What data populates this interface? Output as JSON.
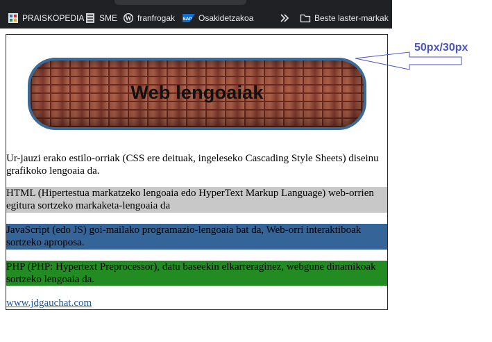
{
  "bookmarks_bar": {
    "items": [
      {
        "label": "PRAISKOPEDIA",
        "icon": "site-favicon-icon"
      },
      {
        "label": "SME",
        "icon": "sme-favicon-icon"
      },
      {
        "label": "franfrogak",
        "icon": "wordpress-icon"
      },
      {
        "label": "Osakidetzakoa",
        "icon": "sap-icon"
      }
    ],
    "overflow_icon": "chevron-double-right-icon",
    "folder": {
      "label": "Beste laster-markak",
      "icon": "folder-icon"
    }
  },
  "page": {
    "banner_title": "Web lengoaiak",
    "paragraphs": [
      "Ur-jauzi erako estilo-orriak (CSS ere deituak, ingeleseko Cascading Style Sheets) diseinu grafikoko lengoaia da.",
      "HTML (Hipertestua markatzeko lengoaia edo HyperText Markup Language) web-orrien egitura sortzeko markaketa-lengoaia da",
      "JavaScript (edo JS) goi-mailako programazio-lengoaia bat da, Web-orri interaktiboak sortzeko aproposa.",
      "PHP (PHP: Hypertext Preprocessor), datu baseekin elkarreraginez, webgune dinamikoak sortzeko lengoaia da."
    ],
    "link_text": "www.jdgauchat.com"
  },
  "annotation": {
    "label": "50px/30px"
  },
  "colors": {
    "toolbar_bg": "#202124",
    "banner_border": "#3a6a96",
    "html_bg": "#c8c8c8",
    "js_bg": "#346498",
    "php_bg": "#228b22",
    "link": "#1a5ab0",
    "annotation": "#4a53c4"
  }
}
